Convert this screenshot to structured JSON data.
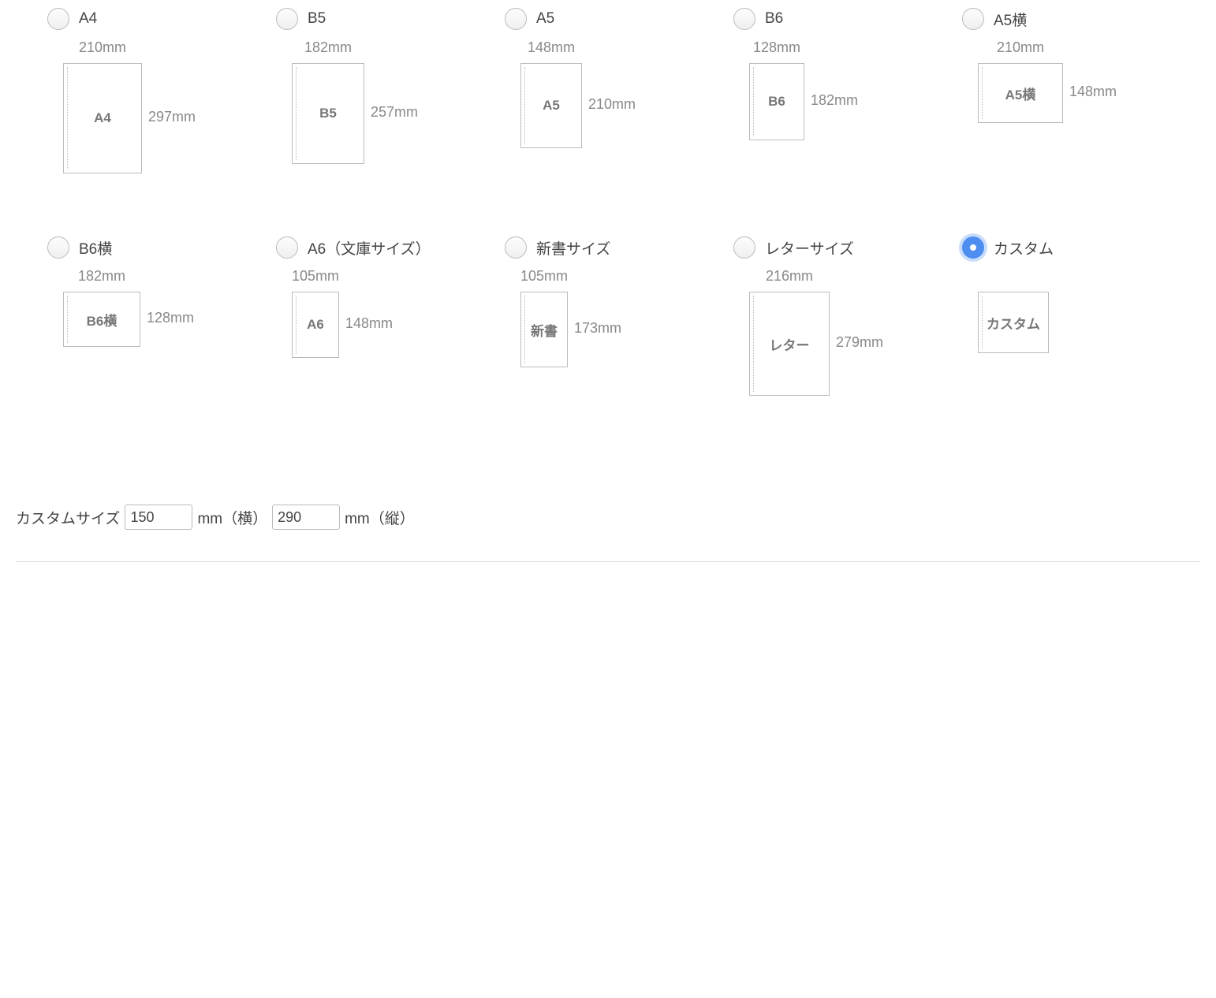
{
  "sizes": [
    {
      "id": "a4",
      "label": "A4",
      "width_label": "210mm",
      "height_label": "297mm",
      "page_label": "A4",
      "pw": 100,
      "ph": 140,
      "selected": false
    },
    {
      "id": "b5",
      "label": "B5",
      "width_label": "182mm",
      "height_label": "257mm",
      "page_label": "B5",
      "pw": 92,
      "ph": 128,
      "selected": false
    },
    {
      "id": "a5",
      "label": "A5",
      "width_label": "148mm",
      "height_label": "210mm",
      "page_label": "A5",
      "pw": 78,
      "ph": 108,
      "selected": false
    },
    {
      "id": "b6",
      "label": "B6",
      "width_label": "128mm",
      "height_label": "182mm",
      "page_label": "B6",
      "pw": 70,
      "ph": 98,
      "selected": false
    },
    {
      "id": "a5l",
      "label": "A5横",
      "width_label": "210mm",
      "height_label": "148mm",
      "page_label": "A5横",
      "pw": 108,
      "ph": 76,
      "selected": false
    },
    {
      "id": "b6l",
      "label": "B6横",
      "width_label": "182mm",
      "height_label": "128mm",
      "page_label": "B6横",
      "pw": 98,
      "ph": 70,
      "selected": false
    },
    {
      "id": "a6",
      "label": "A6（文庫サイズ）",
      "width_label": "105mm",
      "height_label": "148mm",
      "page_label": "A6",
      "pw": 60,
      "ph": 84,
      "selected": false
    },
    {
      "id": "shin",
      "label": "新書サイズ",
      "width_label": "105mm",
      "height_label": "173mm",
      "page_label": "新書",
      "pw": 60,
      "ph": 96,
      "selected": false
    },
    {
      "id": "letter",
      "label": "レターサイズ",
      "width_label": "216mm",
      "height_label": "279mm",
      "page_label": "レター",
      "pw": 102,
      "ph": 132,
      "selected": false
    },
    {
      "id": "custom",
      "label": "カスタム",
      "width_label": "",
      "height_label": "",
      "page_label": "カスタム",
      "pw": 90,
      "ph": 78,
      "selected": true
    }
  ],
  "custom": {
    "title": "カスタムサイズ",
    "width_value": "150",
    "height_value": "290",
    "unit_w": "mm（横）",
    "unit_h": "mm（縦）"
  }
}
